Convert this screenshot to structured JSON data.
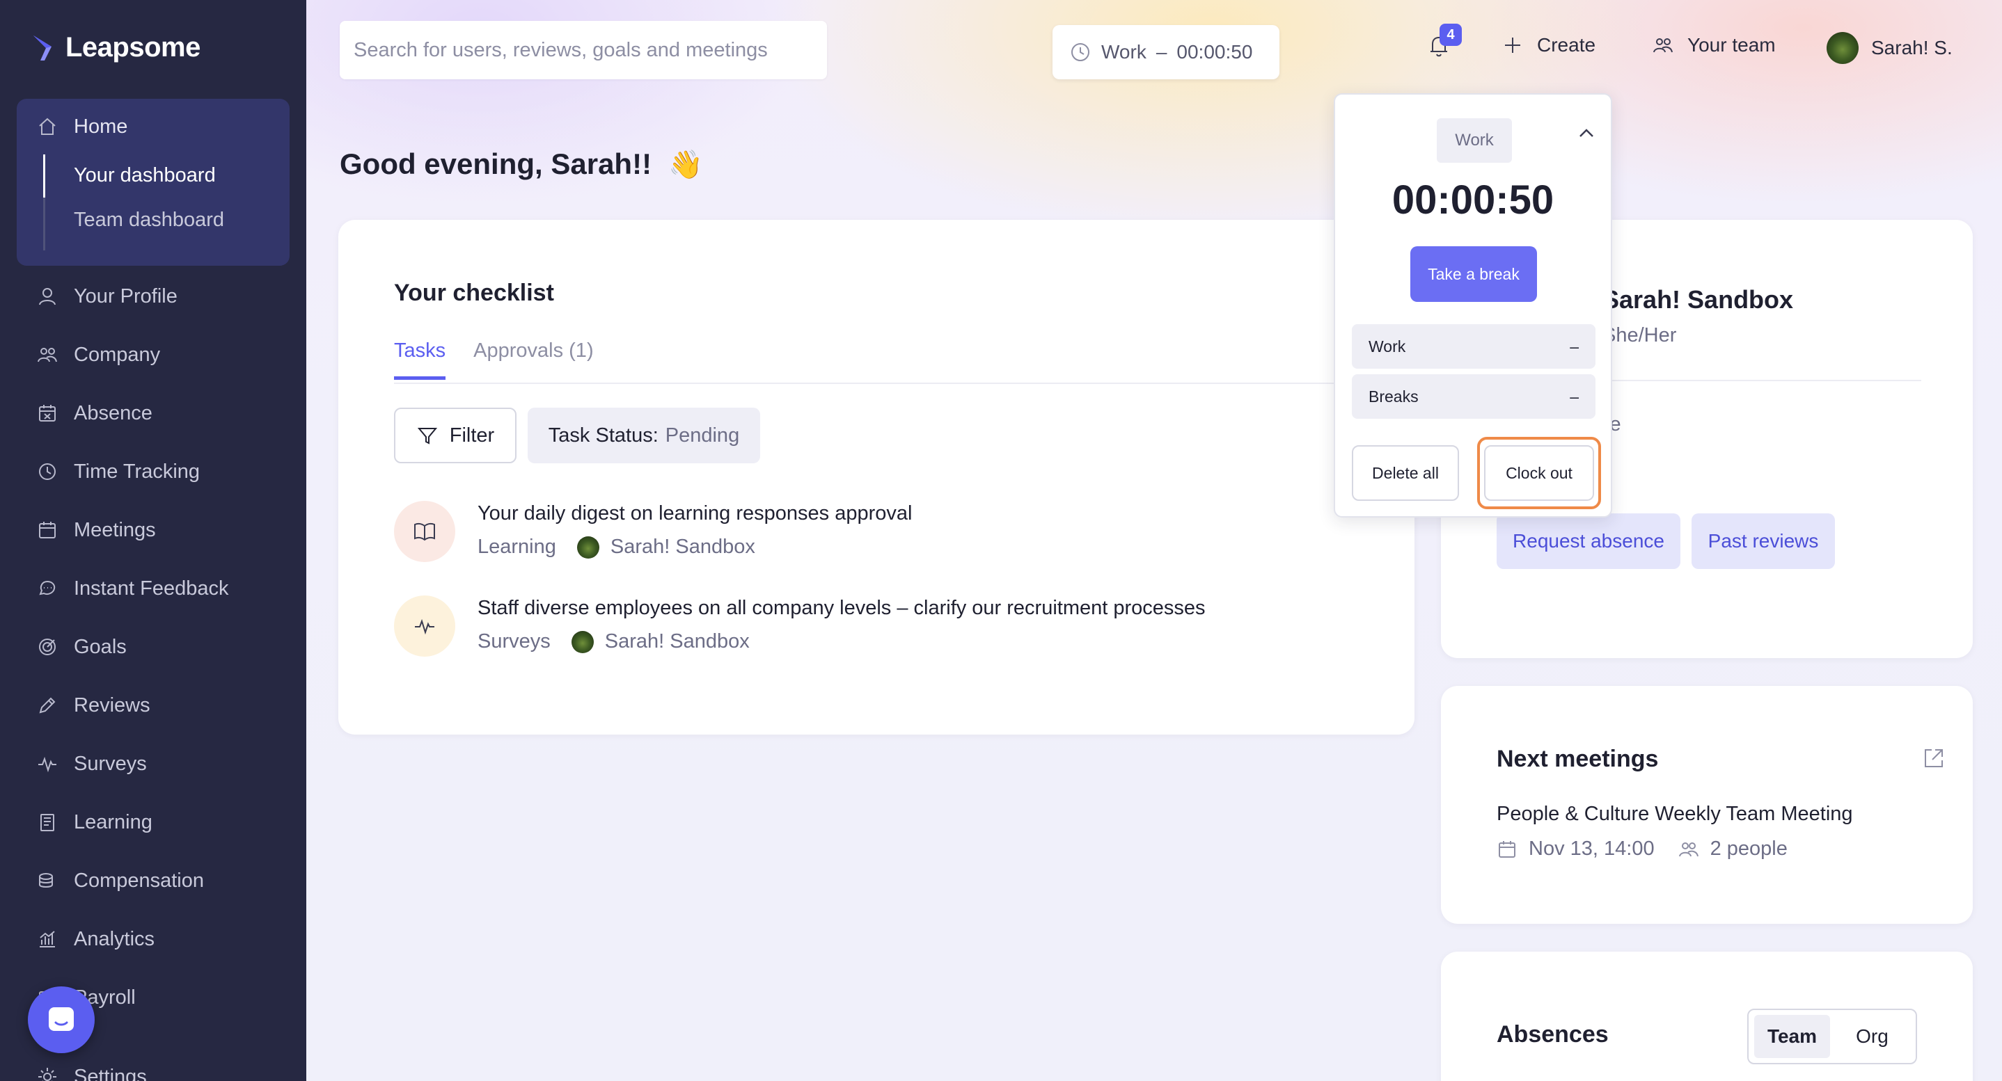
{
  "brand": {
    "name": "Leapsome",
    "accent": "#5b5ef0",
    "sidebar_bg": "#262842"
  },
  "sidebar": {
    "home": {
      "label": "Home",
      "icon": "home-icon"
    },
    "home_sub": [
      {
        "label": "Your dashboard",
        "active": true
      },
      {
        "label": "Team dashboard",
        "active": false
      }
    ],
    "items": [
      {
        "label": "Your Profile",
        "icon": "user-icon"
      },
      {
        "label": "Company",
        "icon": "users-icon"
      },
      {
        "label": "Absence",
        "icon": "calendar-x-icon"
      },
      {
        "label": "Time Tracking",
        "icon": "clock-icon"
      },
      {
        "label": "Meetings",
        "icon": "calendar-icon"
      },
      {
        "label": "Instant Feedback",
        "icon": "chat-icon"
      },
      {
        "label": "Goals",
        "icon": "target-icon"
      },
      {
        "label": "Reviews",
        "icon": "pencil-icon"
      },
      {
        "label": "Surveys",
        "icon": "pulse-icon"
      },
      {
        "label": "Learning",
        "icon": "book-icon"
      },
      {
        "label": "Compensation",
        "icon": "coins-icon"
      },
      {
        "label": "Analytics",
        "icon": "chart-icon"
      },
      {
        "label": "Payroll",
        "icon": "payroll-icon"
      },
      {
        "label": "Settings",
        "icon": "gear-icon"
      }
    ]
  },
  "topbar": {
    "search_placeholder": "Search for users, reviews, goals and meetings",
    "timer": {
      "mode": "Work",
      "separator": "–",
      "time": "00:00:50"
    },
    "notifications_count": "4",
    "create_label": "Create",
    "team_label": "Your team",
    "user_label": "Sarah! S."
  },
  "greeting": {
    "text": "Good evening, Sarah!!",
    "emoji": "👋"
  },
  "checklist": {
    "title": "Your checklist",
    "tabs": [
      {
        "label": "Tasks",
        "active": true
      },
      {
        "label": "Approvals (1)",
        "active": false
      }
    ],
    "filter_label": "Filter",
    "status_label": "Task Status:",
    "status_value": "Pending",
    "tasks": [
      {
        "title": "Your daily digest on learning responses approval",
        "category": "Learning",
        "person": "Sarah! Sandbox",
        "icon": "book-open-icon",
        "icon_bg": "#fbe9e4"
      },
      {
        "title": "Staff diverse employees on all company levels – clarify our recruitment processes",
        "category": "Surveys",
        "person": "Sarah! Sandbox",
        "icon": "pulse-icon",
        "icon_bg": "#fdf2dc"
      }
    ]
  },
  "timer_popup": {
    "mode": "Work",
    "time": "00:00:50",
    "break_label": "Take a break",
    "rows": [
      {
        "label": "Work",
        "value": "–"
      },
      {
        "label": "Breaks",
        "value": "–"
      }
    ],
    "delete_label": "Delete all",
    "clockout_label": "Clock out",
    "highlight_color": "#ef8a48"
  },
  "profile": {
    "name": "Sarah! Sandbox",
    "pronouns": "She/Her",
    "role": "Colleague",
    "email": ".",
    "actions": [
      "Request absence",
      "Past reviews"
    ]
  },
  "meetings": {
    "title": "Next meetings",
    "meeting_title": "People & Culture Weekly Team Meeting",
    "date": "Nov 13, 14:00",
    "people": "2 people"
  },
  "absences": {
    "title": "Absences",
    "segments": [
      {
        "label": "Team",
        "active": true
      },
      {
        "label": "Org",
        "active": false
      }
    ]
  }
}
